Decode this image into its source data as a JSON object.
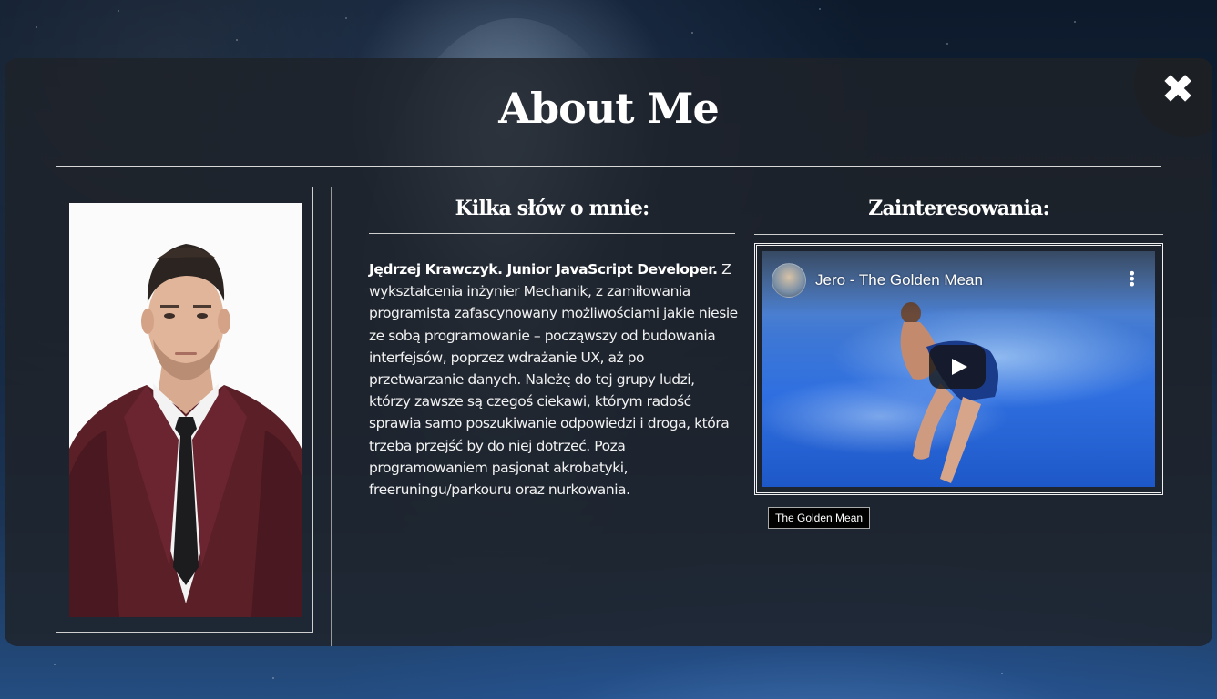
{
  "modal": {
    "title": "About Me",
    "close_icon": "close-icon",
    "close_symbol": "✖"
  },
  "about": {
    "heading": "Kilka słów o mnie:",
    "intro_bold": "Jędrzej Krawczyk. Junior JavaScript Developer.",
    "intro_text": " Z wykształcenia inżynier Mechanik, z zamiłowania programista zafascynowany możliwościami jakie niesie ze sobą programowanie – począwszy od budowania interfejsów, poprzez wdrażanie UX, aż po przetwarzanie danych. Należę do tej grupy ludzi, którzy zawsze są czegoś ciekawi, którym radość sprawia samo poszukiwanie odpowiedzi i droga, która trzeba przejść by do niej dotrzeć. Poza programowaniem pasjonat akrobatyki, freeruningu/parkouru oraz nurkowania."
  },
  "interests": {
    "heading": "Zainteresowania:",
    "video": {
      "title": "Jero - The Golden Mean",
      "tag": "The Golden Mean",
      "play_icon": "play-icon",
      "menu_icon": "more-vertical-icon"
    }
  },
  "colors": {
    "modal_bg": "#1e2228",
    "text": "#ffffff",
    "rule": "#d8d8d8"
  }
}
